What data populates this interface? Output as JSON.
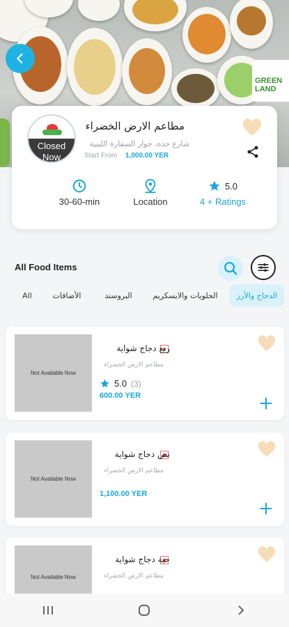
{
  "restaurant": {
    "name": "مطاعم الارض الخضراء",
    "address": "شارع حده، جوار السفارة الليبية",
    "start_from_label": "Start From",
    "start_from_price": "1,000.00 YER",
    "logo_status": "Closed Now",
    "hero_sign_text": "GREEN LAND"
  },
  "stats": {
    "time": "30-60-min",
    "location": "Location",
    "rating_value": "5.0",
    "ratings_count": "4 + Ratings"
  },
  "section": {
    "title": "All Food Items"
  },
  "tabs": [
    {
      "label": "All"
    },
    {
      "label": "الأضافات"
    },
    {
      "label": "البروستد"
    },
    {
      "label": "الحلويات والايسكريم"
    },
    {
      "label": "الدجاج والأرز",
      "active": true
    }
  ],
  "food_items": [
    {
      "name": "ربع دجاج شواية",
      "restaurant": "مطاعم الارض الخضراء",
      "image_text": "Not Available Now",
      "rating": "5.0",
      "rating_count": "(3)",
      "price": "600.00 YER"
    },
    {
      "name": "نص دجاج شواية",
      "restaurant": "مطاعم الارض الخضراء",
      "image_text": "Not Available Now",
      "price": "1,100.00 YER"
    },
    {
      "name": "حبة دجاج شواية",
      "restaurant": "مطاعم الارض الخضراء",
      "image_text": "Not Available Now"
    }
  ],
  "colors": {
    "accent": "#1aa7d8",
    "favorite": "#f6ddb8",
    "closed_overlay": "#3a3a3a"
  },
  "icons": {
    "back": "chevron-left-icon",
    "favorite": "heart-icon",
    "share": "share-icon",
    "time": "clock-icon",
    "location": "map-pin-icon",
    "rating": "star-icon",
    "search": "search-icon",
    "filter": "sliders-icon",
    "add": "plus-icon"
  }
}
